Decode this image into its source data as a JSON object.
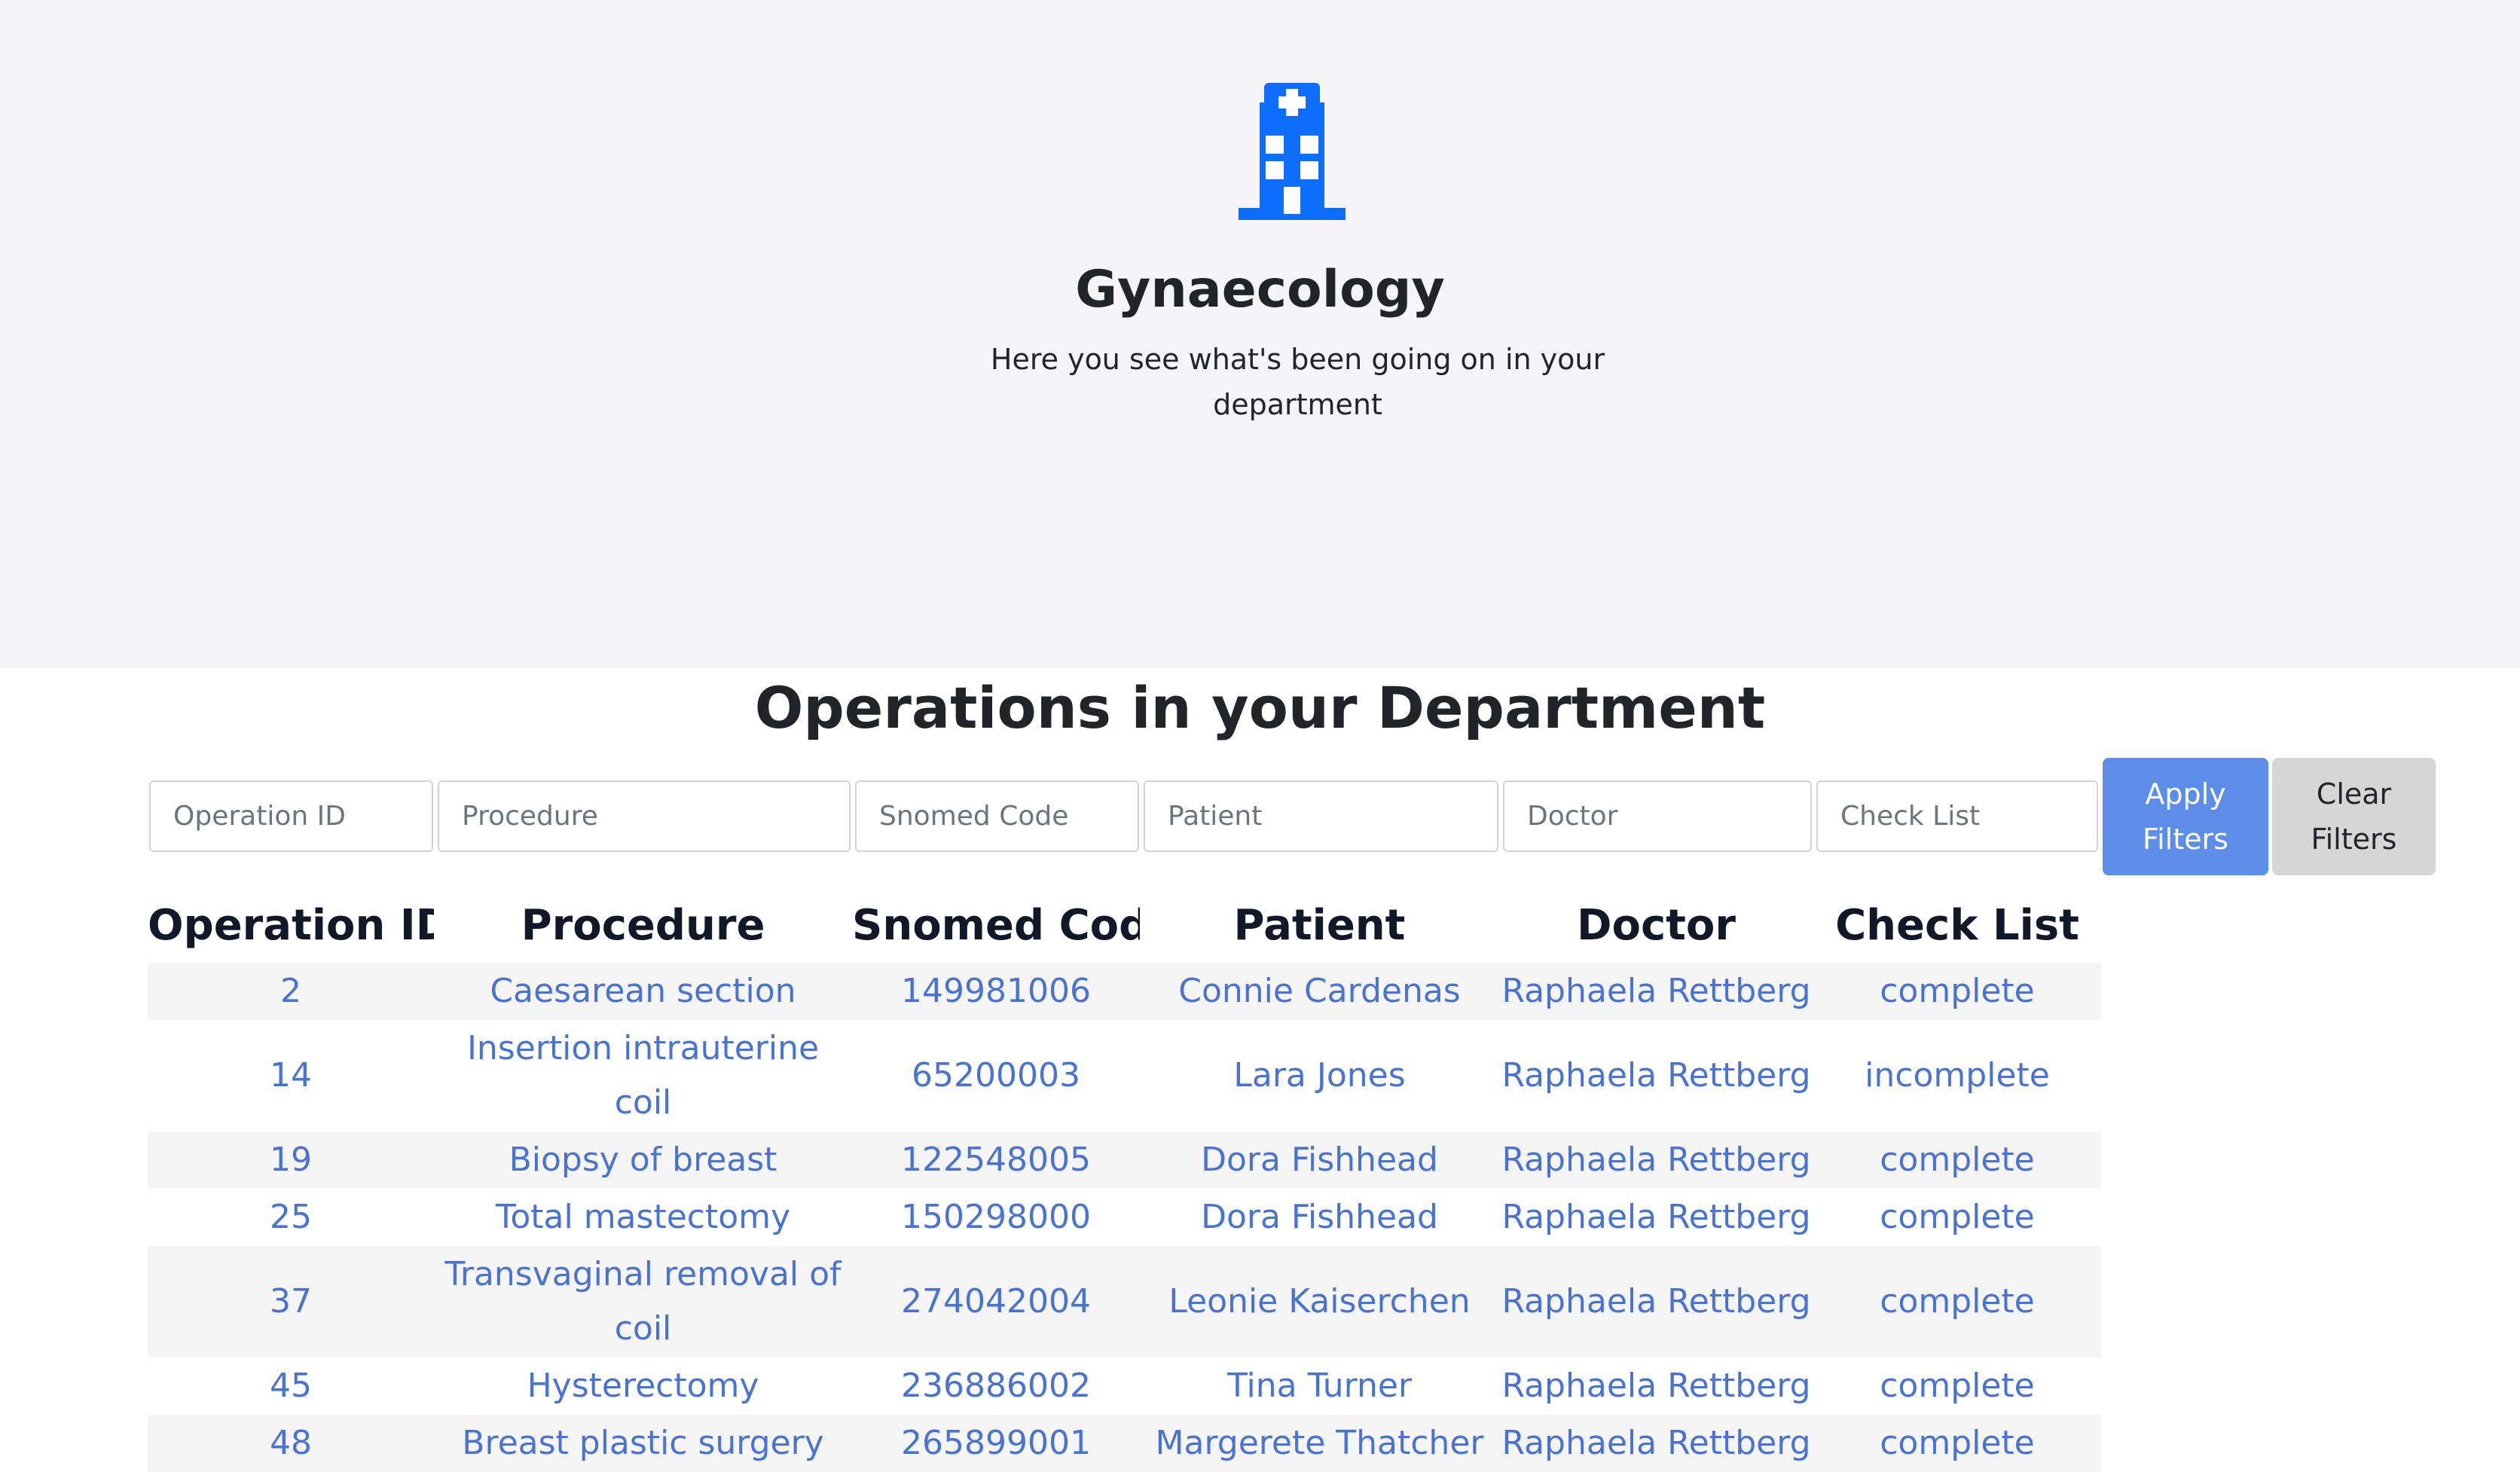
{
  "hero": {
    "icon": "hospital-icon",
    "title": "Gynaecology",
    "subtitle": "Here you see what's been going on in your department"
  },
  "section": {
    "title": "Operations in your Department"
  },
  "filters": {
    "operation_id_placeholder": "Operation ID",
    "procedure_placeholder": "Procedure",
    "snomed_placeholder": "Snomed Code",
    "patient_placeholder": "Patient",
    "doctor_placeholder": "Doctor",
    "checklist_placeholder": "Check List",
    "apply_label": "Apply Filters",
    "clear_label": "Clear Filters"
  },
  "table": {
    "headers": [
      "Operation ID",
      "Procedure",
      "Snomed Code",
      "Patient",
      "Doctor",
      "Check List"
    ],
    "rows": [
      [
        "2",
        "Caesarean section",
        "149981006",
        "Connie Cardenas",
        "Raphaela Rettberg",
        "complete"
      ],
      [
        "14",
        "Insertion intrauterine coil",
        "65200003",
        "Lara Jones",
        "Raphaela Rettberg",
        "incomplete"
      ],
      [
        "19",
        "Biopsy of breast",
        "122548005",
        "Dora Fishhead",
        "Raphaela Rettberg",
        "complete"
      ],
      [
        "25",
        "Total mastectomy",
        "150298000",
        "Dora Fishhead",
        "Raphaela Rettberg",
        "complete"
      ],
      [
        "37",
        "Transvaginal removal of coil",
        "274042004",
        "Leonie Kaiserchen",
        "Raphaela Rettberg",
        "complete"
      ],
      [
        "45",
        "Hysterectomy",
        "236886002",
        "Tina Turner",
        "Raphaela Rettberg",
        "complete"
      ],
      [
        "48",
        "Breast plastic surgery",
        "265899001",
        "Margerete Thatcher",
        "Raphaela Rettberg",
        "complete"
      ]
    ]
  },
  "colors": {
    "accent": "#0d6efd",
    "link": "#4a73d1",
    "apply_button": "#5c8de8",
    "clear_button": "#d6d6d6",
    "hero_bg": "#f5f5f7"
  }
}
